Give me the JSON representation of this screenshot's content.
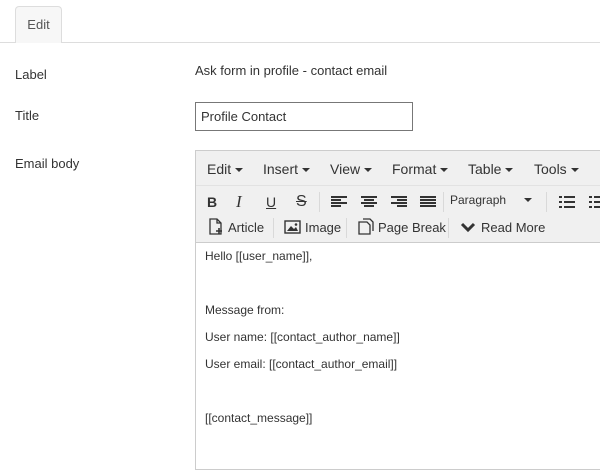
{
  "tabs": [
    {
      "label": "Edit"
    }
  ],
  "form": {
    "label": {
      "name": "Label",
      "value": "Ask form in profile - contact email"
    },
    "title": {
      "name": "Title",
      "value": "Profile Contact"
    },
    "email_body": {
      "name": "Email body"
    }
  },
  "editor": {
    "menu": [
      "Edit",
      "Insert",
      "View",
      "Format",
      "Table",
      "Tools"
    ],
    "toolbar": {
      "bold": "B",
      "italic": "I",
      "underline": "U",
      "strike": "S",
      "paragraph": "Paragraph",
      "article": "Article",
      "image": "Image",
      "page_break": "Page Break",
      "read_more": "Read More"
    },
    "content": [
      "Hello [[user_name]],",
      "",
      "Message from:",
      "User name: [[contact_author_name]]",
      "User email: [[contact_author_email]]",
      "",
      "[[contact_message]]"
    ]
  }
}
